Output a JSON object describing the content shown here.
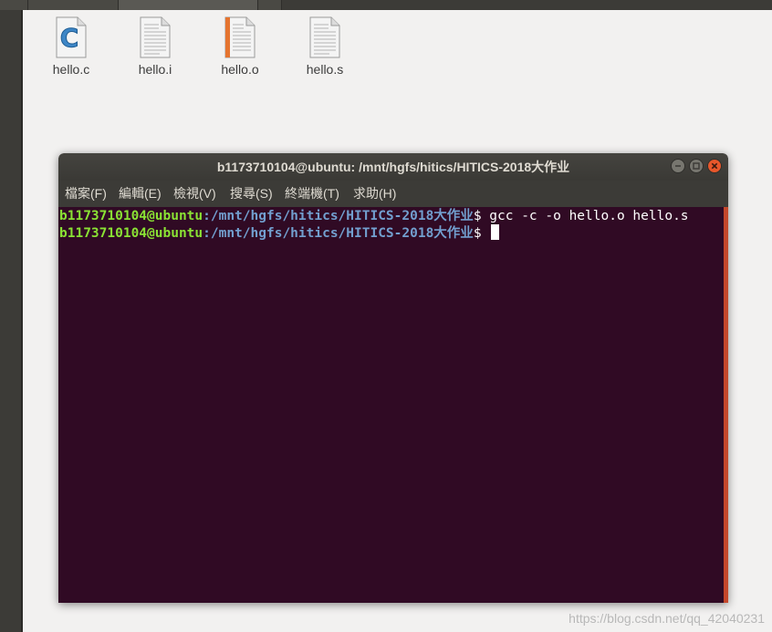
{
  "files": [
    {
      "name": "hello.c",
      "icon": "c-source-file-icon"
    },
    {
      "name": "hello.i",
      "icon": "text-file-icon"
    },
    {
      "name": "hello.o",
      "icon": "object-file-icon"
    },
    {
      "name": "hello.s",
      "icon": "text-file-icon"
    }
  ],
  "terminal": {
    "title": "b1173710104@ubuntu: /mnt/hgfs/hitics/HITICS-2018大作业",
    "menu": [
      "檔案(F)",
      "編輯(E)",
      "檢視(V)",
      "搜尋(S)",
      "終端機(T)",
      "求助(H)"
    ],
    "lines": [
      {
        "user": "b1173710104@ubuntu",
        "path": ":/mnt/hgfs/hitics/HITICS-2018大作业",
        "prompt": "$ ",
        "command": "gcc -c -o hello.o hello.s"
      },
      {
        "user": "b1173710104@ubuntu",
        "path": ":/mnt/hgfs/hitics/HITICS-2018大作业",
        "prompt": "$ ",
        "command": ""
      }
    ],
    "colors": {
      "background": "#300a24",
      "user": "#8ae234",
      "path": "#729fcf",
      "close": "#e8572b"
    }
  },
  "watermark": "https://blog.csdn.net/qq_42040231"
}
